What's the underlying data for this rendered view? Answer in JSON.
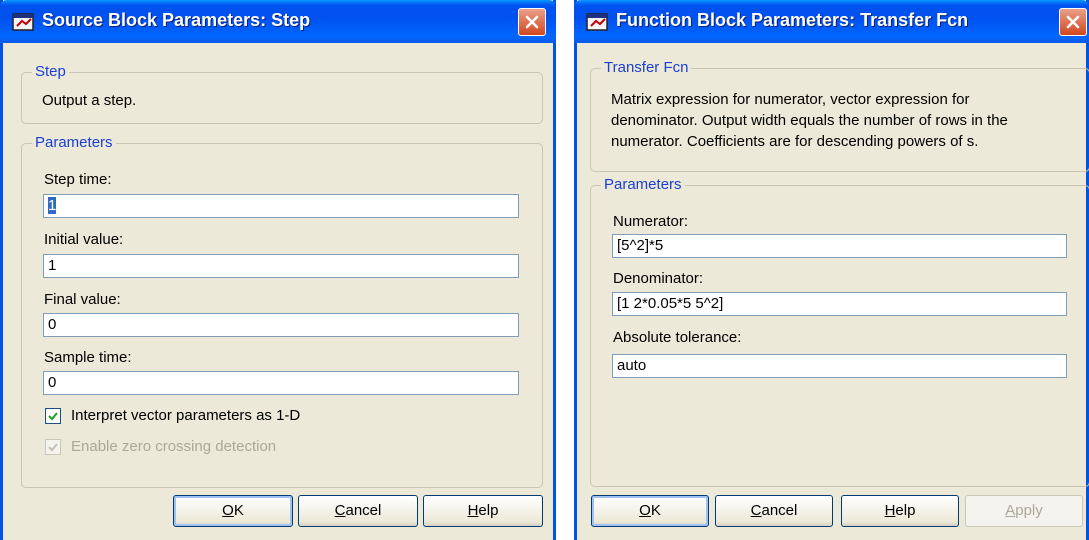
{
  "dialogs": [
    {
      "title": "Source Block Parameters: Step",
      "block_group": "Step",
      "description": "Output a step.",
      "params_group": "Parameters",
      "fields": [
        {
          "label": "Step time:",
          "value": "1"
        },
        {
          "label": "Initial value:",
          "value": "1"
        },
        {
          "label": "Final value:",
          "value": "0"
        },
        {
          "label": "Sample time:",
          "value": "0"
        }
      ],
      "checkboxes": [
        {
          "label": "Interpret vector parameters as 1-D",
          "checked": true,
          "enabled": true
        },
        {
          "label": "Enable zero crossing detection",
          "checked": true,
          "enabled": false
        }
      ],
      "buttons": {
        "ok": {
          "mnemonic": "O",
          "rest": "K"
        },
        "cancel": {
          "mnemonic": "C",
          "rest": "ancel"
        },
        "help": {
          "mnemonic": "H",
          "rest": "elp"
        }
      }
    },
    {
      "title": "Function Block Parameters: Transfer Fcn",
      "block_group": "Transfer Fcn",
      "description_lines": [
        "Matrix expression for numerator, vector expression for",
        "denominator.  Output width equals the number of rows in the",
        "numerator.  Coefficients are for descending powers of s."
      ],
      "params_group": "Parameters",
      "fields": [
        {
          "label": "Numerator:",
          "value": "[5^2]*5"
        },
        {
          "label": "Denominator:",
          "value": "[1 2*0.05*5 5^2]"
        },
        {
          "label": "Absolute tolerance:",
          "value": "auto"
        }
      ],
      "buttons": {
        "ok": {
          "mnemonic": "O",
          "rest": "K"
        },
        "cancel": {
          "mnemonic": "C",
          "rest": "ancel"
        },
        "help": {
          "mnemonic": "H",
          "rest": "elp"
        },
        "apply": {
          "mnemonic": "A",
          "rest": "pply",
          "enabled": false
        }
      }
    }
  ],
  "icons": [
    "simulink-block-icon",
    "close-icon",
    "checkmark-icon"
  ],
  "colors": {
    "titlebar": "#0054e3",
    "dialog_bg": "#ece9d8",
    "group_title": "#1c3fd3",
    "close": "#d2471f"
  }
}
